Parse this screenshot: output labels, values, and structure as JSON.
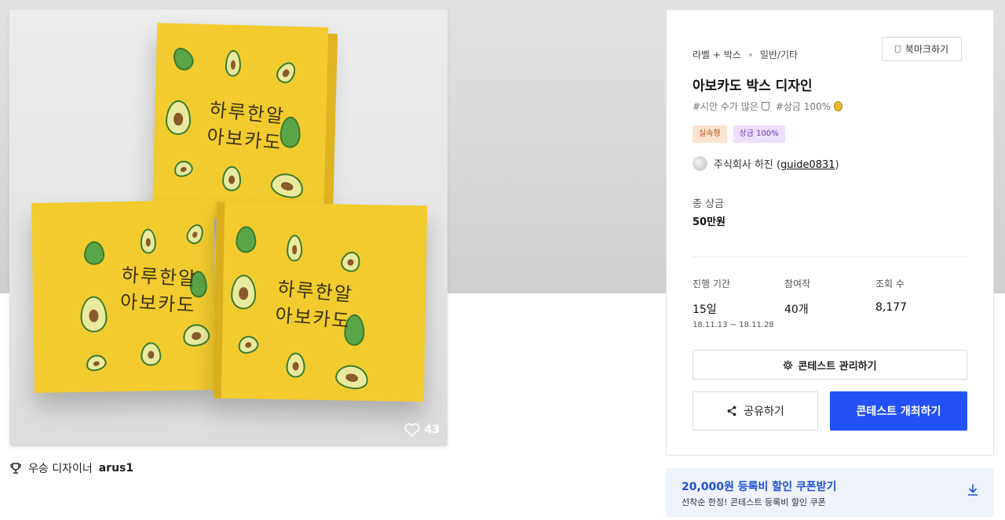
{
  "gallery": {
    "likes_count": "43",
    "box_lettering": {
      "line1": "하루한알",
      "line2": "아보카도"
    }
  },
  "designer": {
    "prefix": "우승 디자이너",
    "name": "arus1"
  },
  "contest": {
    "category_main": "라벨 + 박스",
    "category_sub": "일반/기타",
    "bookmark_label": "북마크하기",
    "title": "아보카도 박스 디자인",
    "tag1": "#시안 수가 많은",
    "tag2": "#상금 100%",
    "badge_type": "실속형",
    "badge_prize": "상금 100%",
    "host_name": "주식회사 하진 (",
    "host_id": "guide0831",
    "host_suffix": ")",
    "prize_label": "총 상금",
    "prize_value": "50만원",
    "stats": {
      "period_label": "진행 기간",
      "period_value": "15일",
      "period_range": "18.11.13 ~ 18.11.28",
      "participants_label": "참여작",
      "participants_value": "40개",
      "views_label": "조회 수",
      "views_value": "8,177"
    },
    "manage_label": "콘테스트 관리하기",
    "share_label": "공유하기",
    "host_label": "콘테스트 개최하기"
  },
  "coupon": {
    "title": "20,000원 등록비 할인 쿠폰받기",
    "subtitle": "선착순 한정! 콘테스트 등록비 할인 쿠폰"
  },
  "colors": {
    "primary": "#2252f5",
    "coupon_title": "#1f4fd6",
    "coupon_bg": "#eef3fc",
    "box_yellow": "#f2cc2e"
  },
  "icons": [
    "heart-icon",
    "trophy-icon",
    "bookmark-icon",
    "medal-icon",
    "gear-icon",
    "share-icon",
    "download-icon"
  ]
}
